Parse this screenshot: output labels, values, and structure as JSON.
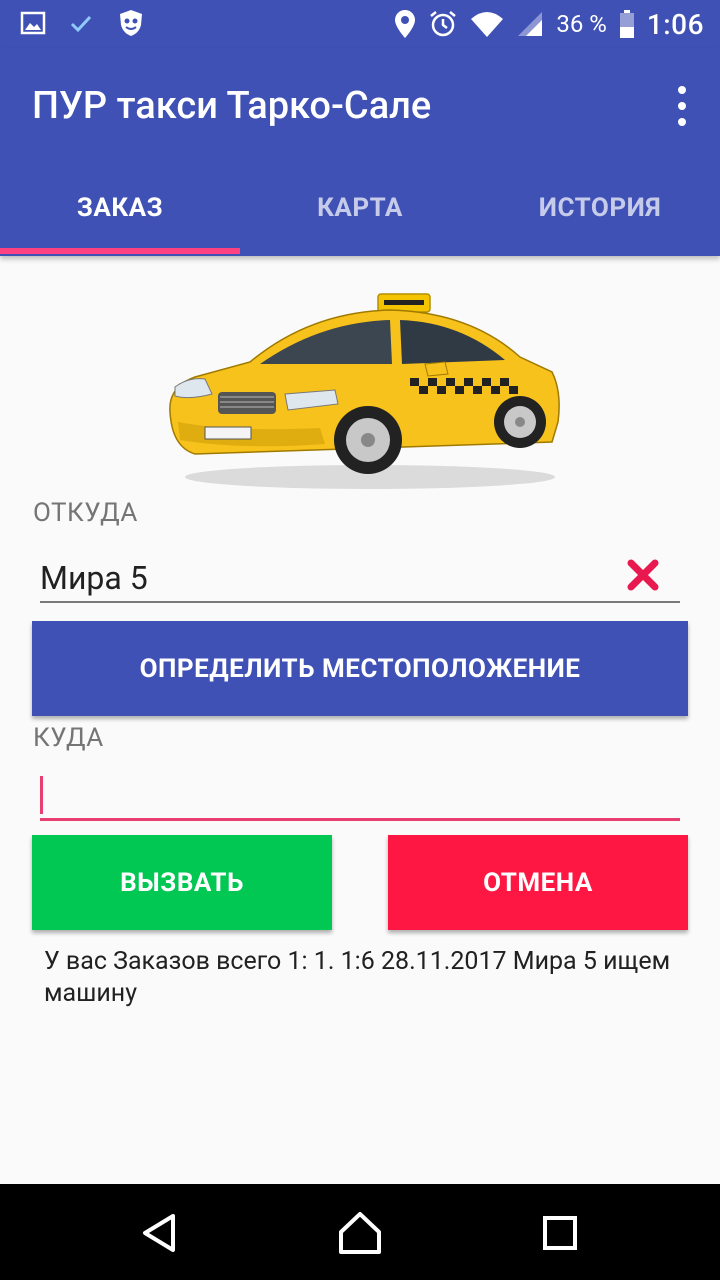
{
  "status_bar": {
    "battery_percent": "36 %",
    "time": "1:06",
    "icons": [
      "image-icon",
      "check-icon",
      "shield-icon",
      "location-icon",
      "alarm-icon",
      "wifi-icon",
      "signal-icon",
      "battery-icon"
    ]
  },
  "app": {
    "title": "ПУР такси Тарко-Сале",
    "menu_icon": "more-vert-icon"
  },
  "tabs": [
    {
      "label": "ЗАКАЗ",
      "active": true
    },
    {
      "label": "КАРТА",
      "active": false
    },
    {
      "label": "ИСТОРИЯ",
      "active": false
    }
  ],
  "form": {
    "from_label": "ОТКУДА",
    "from_value": "Мира 5",
    "clear_icon": "close-icon",
    "locate_button": "ОПРЕДЕЛИТЬ МЕСТОПОЛОЖЕНИЕ",
    "to_label": "КУДА",
    "to_value": "",
    "call_button": "ВЫЗВАТЬ",
    "cancel_button": "ОТМЕНА"
  },
  "order_status": "У вас Заказов всего 1:  1. 1:6 28.11.2017 Мира 5 ищем машину",
  "colors": {
    "primary": "#3f51b5",
    "accent": "#ff4081",
    "call": "#00c853",
    "cancel": "#ff1744"
  },
  "nav_bar": [
    "back-icon",
    "home-icon",
    "recents-icon"
  ]
}
